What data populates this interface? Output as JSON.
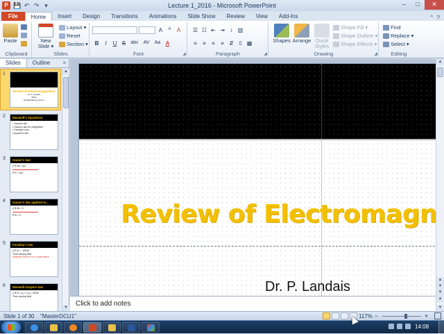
{
  "window": {
    "title": "Lecture 1_2016 - Microsoft PowerPoint",
    "controls": {
      "minimize": "–",
      "maximize": "□",
      "close": "✕"
    }
  },
  "qat": {
    "save": "💾",
    "undo": "↶",
    "redo": "↷",
    "customize": "▾"
  },
  "tabs": {
    "file": "File",
    "items": [
      "Home",
      "Insert",
      "Design",
      "Transitions",
      "Animations",
      "Slide Show",
      "Review",
      "View",
      "Add-Ins"
    ],
    "active": "Home"
  },
  "ribbon": {
    "clipboard": {
      "label": "Clipboard",
      "paste": "Paste"
    },
    "slides": {
      "label": "Slides",
      "new_slide": "New Slide ▾",
      "layout": "Layout ▾",
      "reset": "Reset",
      "section": "Section ▾"
    },
    "font": {
      "label": "Font",
      "bold": "B",
      "italic": "I",
      "underline": "U",
      "strike": "S",
      "shadow": "abc",
      "spacing": "AV",
      "case": "Aa",
      "grow": "A",
      "shrink": "A",
      "clear": "A",
      "color": "A"
    },
    "paragraph": {
      "label": "Paragraph"
    },
    "drawing": {
      "label": "Drawing",
      "shapes": "Shapes",
      "arrange": "Arrange",
      "quick_styles": "Quick Styles",
      "shape_fill": "Shape Fill ▾",
      "shape_outline": "Shape Outline ▾",
      "shape_effects": "Shape Effects ▾"
    },
    "editing": {
      "label": "Editing",
      "find": "Find",
      "replace": "Replace ▾",
      "select": "Select ▾"
    }
  },
  "left_panel": {
    "tabs": [
      "Slides",
      "Outline"
    ],
    "close": "×",
    "slides": [
      {
        "num": "1",
        "title": "Review of Electromagnetism",
        "lines": [
          "Dr. P. Landais",
          "Office",
          "landaisp@eeng.dcu.ie"
        ]
      },
      {
        "num": "2",
        "title": "Maxwell's equations",
        "lines": [
          "• Gauss's law",
          "• Gauss's law for magnetism",
          "• Faraday's law",
          "• Ampère's law"
        ]
      },
      {
        "num": "3",
        "title": "Gauss's law",
        "lines": [
          "∮ E·dA = q/ε₀",
          "∇·E = ρ/ε₀"
        ]
      },
      {
        "num": "4",
        "title": "Gauss's law applied to...",
        "lines": [
          "∮ B·dA = 0",
          "∇·B = 0"
        ]
      },
      {
        "num": "5",
        "title": "Faraday's law",
        "lines": [
          "∮ E·dl = −dΦ/dt",
          "Time varying field",
          "Magnetic field is non-conservative"
        ]
      },
      {
        "num": "6",
        "title": "Maxwell-Ampere law",
        "lines": [
          "∮ B·dl = μ₀I + μ₀ε₀ dΦ/dt",
          "Time varying field"
        ]
      }
    ]
  },
  "slide": {
    "title": "Review of Electromagne",
    "author": "Dr. P. Landais"
  },
  "notes": {
    "placeholder": "Click to add notes"
  },
  "status": {
    "slide_info": "Slide 1 of 30",
    "theme": "\"MasterDCU1\"",
    "zoom": "117%",
    "zoom_fraction": 0.62,
    "zoom_minus": "−",
    "zoom_plus": "+"
  },
  "taskbar": {
    "clock": "14:08"
  },
  "colors": {
    "title_yellow": "#f3c000",
    "file_tab": "#d24726",
    "taskbar": "#1d3f66"
  }
}
